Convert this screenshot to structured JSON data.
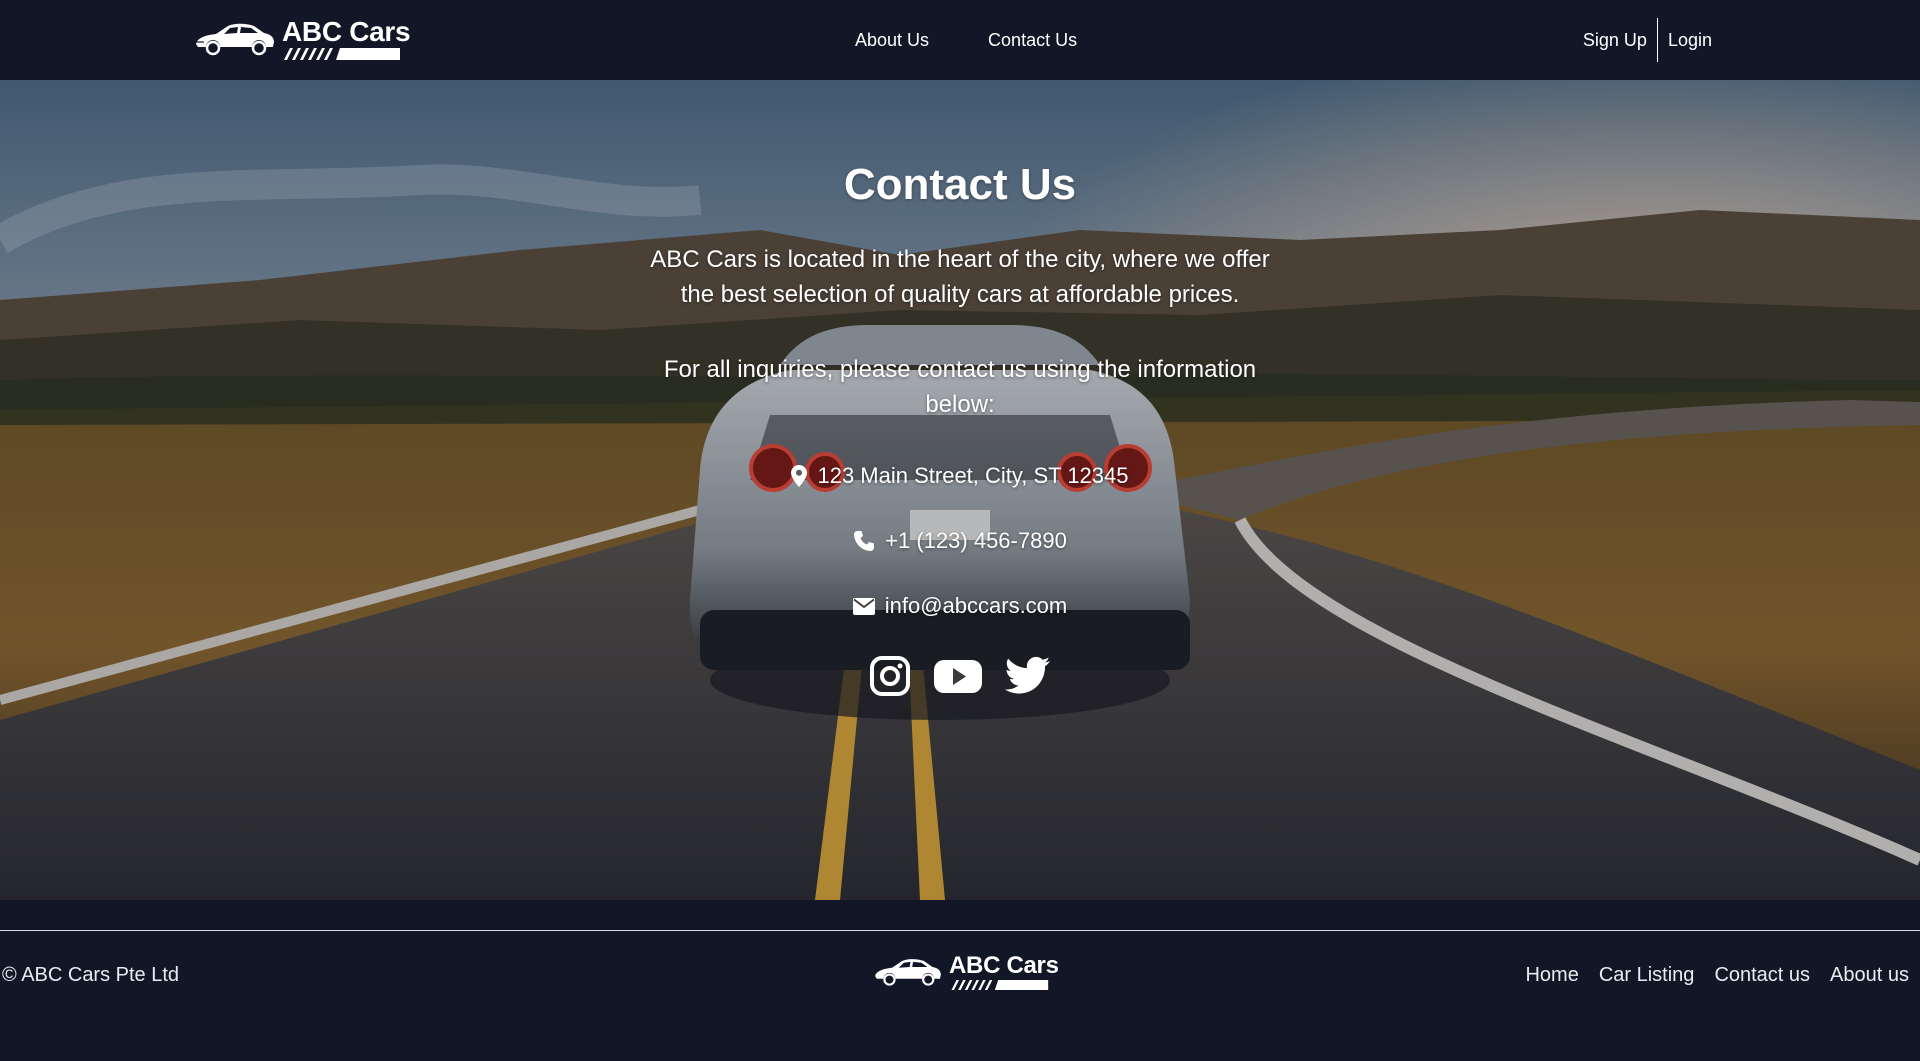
{
  "brand": {
    "name": "ABC Cars"
  },
  "nav": {
    "center_links": [
      "About Us",
      "Contact Us"
    ],
    "signup": "Sign Up",
    "login": "Login"
  },
  "hero": {
    "title": "Contact Us",
    "paragraph1": "ABC Cars is located in the heart of the city, where we offer the best selection of quality cars at affordable prices.",
    "paragraph2": "For all inquiries, please contact us using the information below:",
    "address": "123 Main Street, City, ST 12345",
    "phone": "+1 (123) 456-7890",
    "email": "info@abccars.com",
    "address_icon": "map-marker-icon",
    "phone_icon": "phone-icon",
    "email_icon": "envelope-icon",
    "social_icons": [
      "instagram-icon",
      "youtube-icon",
      "twitter-icon"
    ]
  },
  "footer": {
    "copyright": "© ABC Cars Pte Ltd",
    "links": [
      "Home",
      "Car Listing",
      "Contact us",
      "About us"
    ]
  },
  "colors": {
    "header_bg": "#111727",
    "footer_bg": "#111727",
    "text": "#ffffff"
  }
}
